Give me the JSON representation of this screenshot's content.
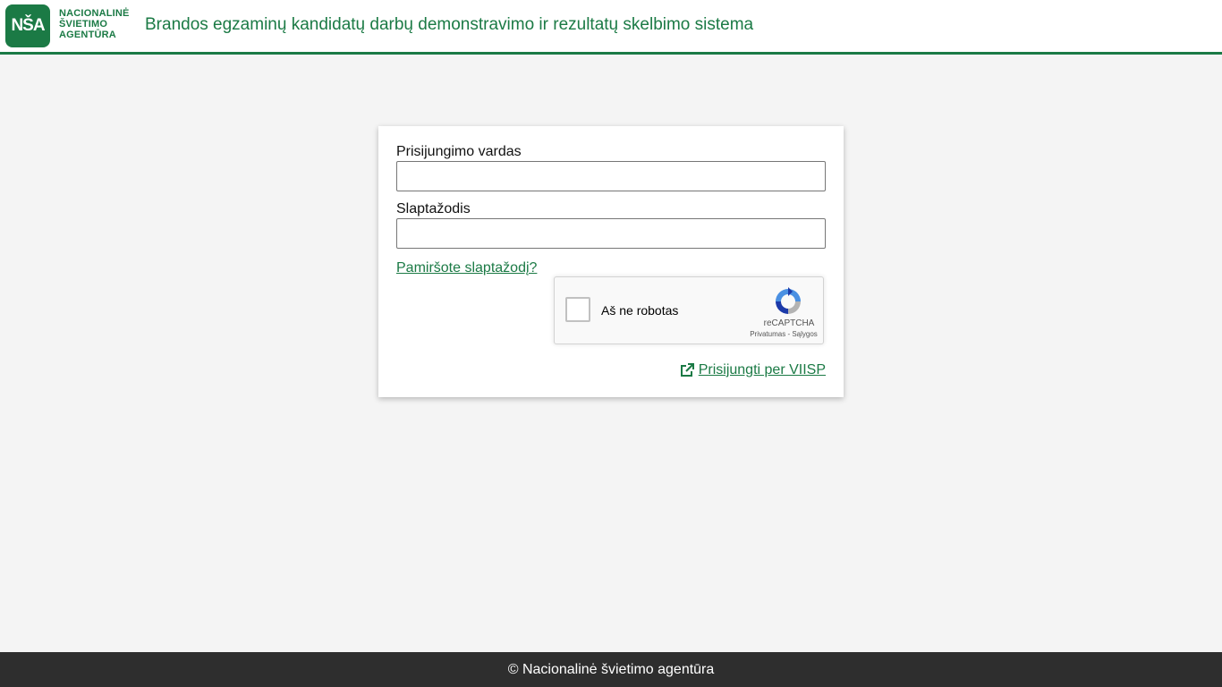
{
  "header": {
    "logo": {
      "mark": "NŠA",
      "lines": [
        "NACIONALINĖ",
        "ŠVIETIMO",
        "AGENTŪRA"
      ]
    },
    "title": "Brandos egzaminų kandidatų darbų demonstravimo ir rezultatų skelbimo sistema"
  },
  "login": {
    "username_label": "Prisijungimo vardas",
    "username_value": "",
    "password_label": "Slaptažodis",
    "password_value": "",
    "forgot_link": "Pamiršote slaptažodį?",
    "recaptcha": {
      "label": "Aš ne robotas",
      "brand": "reCAPTCHA",
      "links": "Privatumas - Sąlygos"
    },
    "viisp_link": "Prisijungti per VIISP",
    "viisp_icon": "external-link-icon"
  },
  "footer": {
    "text": "© Nacionalinė švietimo agentūra"
  },
  "colors": {
    "brand_green": "#1b7a45",
    "background": "#f4f4f4",
    "footer_bg": "#2e2e2e"
  }
}
